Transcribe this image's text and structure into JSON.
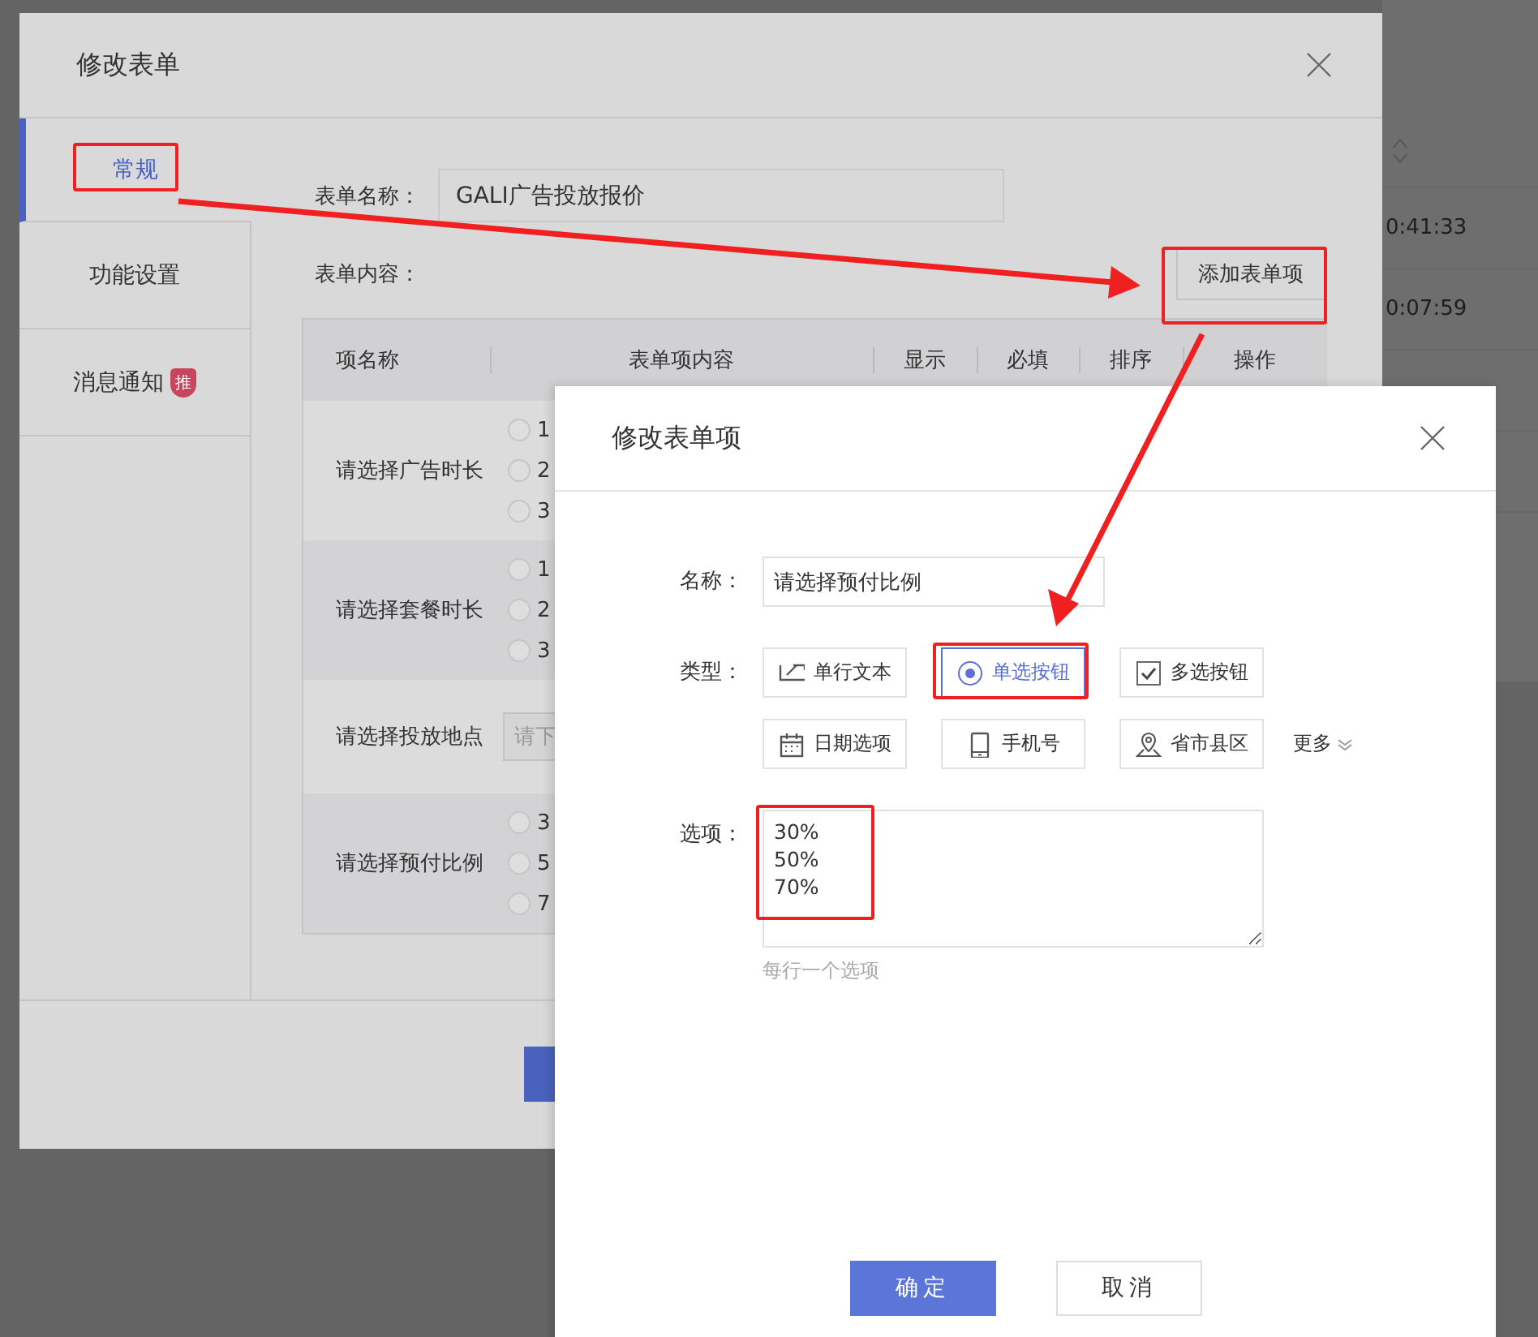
{
  "background_page": {
    "times": [
      "0:41:33",
      "0:07:59"
    ]
  },
  "form_dialog": {
    "title": "修改表单",
    "tabs": [
      {
        "label": "常规",
        "selected": true
      },
      {
        "label": "功能设置",
        "selected": false
      },
      {
        "label": "消息通知",
        "selected": false,
        "badge": "推"
      }
    ],
    "name_label": "表单名称：",
    "name_value": "GALI广告投放报价",
    "content_label": "表单内容：",
    "add_button": "添加表单项",
    "table": {
      "columns": [
        "项名称",
        "表单项内容",
        "显示",
        "必填",
        "排序",
        "操作"
      ],
      "rows": [
        {
          "name": "请选择广告时长",
          "kind": "radio",
          "options": [
            {
              "label": "1",
              "selected": false
            },
            {
              "label": "2",
              "selected": false
            },
            {
              "label": "3",
              "selected": false
            }
          ]
        },
        {
          "name": "请选择套餐时长",
          "kind": "radio",
          "options": [
            {
              "label": "1",
              "selected": false
            },
            {
              "label": "2",
              "selected": false
            },
            {
              "label": "3",
              "selected": false
            }
          ]
        },
        {
          "name": "请选择投放地点",
          "kind": "select",
          "placeholder": "请下"
        },
        {
          "name": "请选择预付比例",
          "kind": "radio",
          "options": [
            {
              "label": "3",
              "selected": false
            },
            {
              "label": "5",
              "selected": false
            },
            {
              "label": "7",
              "selected": false
            }
          ]
        }
      ]
    },
    "footer_buttons": [
      {
        "kind": "primary"
      }
    ]
  },
  "item_dialog": {
    "title": "修改表单项",
    "name_label": "名称：",
    "name_value": "请选择预付比例",
    "type_label": "类型：",
    "types": [
      {
        "label": "单行文本",
        "kind": "text",
        "selected": false
      },
      {
        "label": "单选按钮",
        "kind": "radio",
        "selected": true
      },
      {
        "label": "多选按钮",
        "kind": "checkbox",
        "selected": false
      },
      {
        "label": "日期选项",
        "kind": "date",
        "selected": false
      },
      {
        "label": "手机号",
        "kind": "phone",
        "selected": false
      },
      {
        "label": "省市县区",
        "kind": "region",
        "selected": false
      }
    ],
    "more": "更多",
    "options_label": "选项：",
    "options_value": "30%\n50%\n70%",
    "hint": "每行一个选项",
    "buttons": [
      {
        "label": "确定",
        "kind": "primary"
      },
      {
        "label": "取消",
        "kind": "default"
      }
    ]
  }
}
